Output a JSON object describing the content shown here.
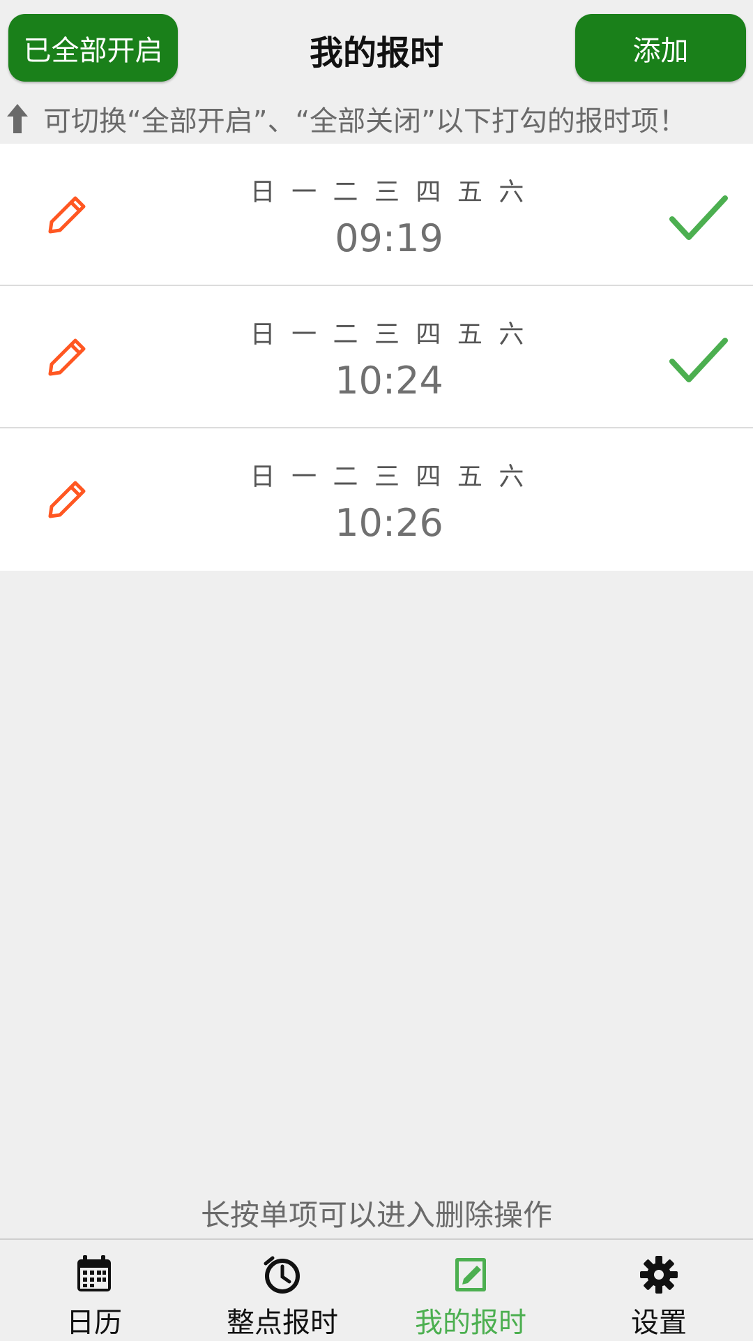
{
  "header": {
    "toggle_all_label": "已全部开启",
    "title": "我的报时",
    "add_label": "添加"
  },
  "hint": "可切换“全部开启”、“全部关闭”以下打勾的报时项！",
  "alarms": [
    {
      "days": "日 一 二 三 四 五 六",
      "time": "09:19",
      "checked": true
    },
    {
      "days": "日 一 二 三 四 五 六",
      "time": "10:24",
      "checked": true
    },
    {
      "days": "日 一 二 三 四 五 六",
      "time": "10:26",
      "checked": false
    }
  ],
  "footer_hint": "长按单项可以进入删除操作",
  "nav": {
    "items": [
      {
        "label": "日历",
        "icon": "calendar-icon"
      },
      {
        "label": "整点报时",
        "icon": "clock-icon"
      },
      {
        "label": "我的报时",
        "icon": "edit-note-icon",
        "active": true
      },
      {
        "label": "设置",
        "icon": "gear-icon"
      }
    ]
  },
  "colors": {
    "primary": "#1a801a",
    "active": "#4caf50",
    "edit": "#ff5722",
    "check": "#4caf50"
  }
}
